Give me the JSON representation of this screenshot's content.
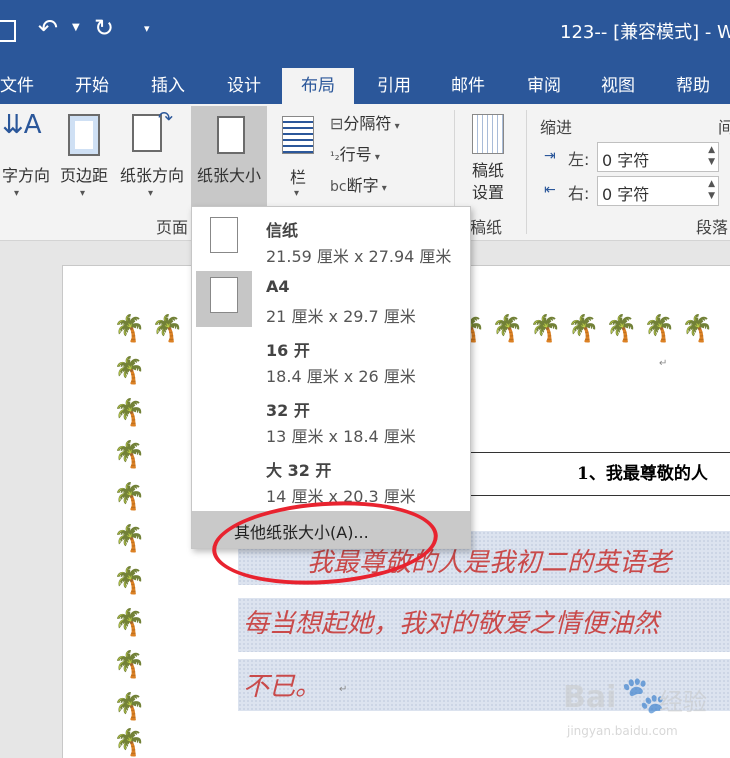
{
  "title_bar": {
    "title": "123-- [兼容模式] -  W"
  },
  "tabs": [
    "文件",
    "开始",
    "插入",
    "设计",
    "布局",
    "引用",
    "邮件",
    "审阅",
    "视图",
    "帮助"
  ],
  "active_tab": "布局",
  "ribbon": {
    "text_direction": "字方向",
    "margins": "页边距",
    "orientation": "纸张方向",
    "size": "纸张大小",
    "columns": "栏",
    "breaks": "分隔符",
    "line_numbers": "行号",
    "hyphenation": "断字",
    "page_setup_group": "页面",
    "draft_paper": "稿纸\n设置",
    "draft_group": "稿纸",
    "indent_label": "缩进",
    "spacing_label_partial": "间",
    "indent_left_label": "左:",
    "indent_left_value": "0 字符",
    "indent_right_label": "右:",
    "indent_right_value": "0 字符",
    "paragraph_group": "段落"
  },
  "dropdown": {
    "options": [
      {
        "name": "信纸",
        "dims": "21.59 厘米 x 27.94 厘米",
        "selected": false
      },
      {
        "name": "A4",
        "dims": "21 厘米 x 29.7 厘米",
        "selected": true
      },
      {
        "name": "16 开",
        "dims": "18.4 厘米 x 26 厘米",
        "selected": false
      },
      {
        "name": "32 开",
        "dims": "13 厘米 x 18.4 厘米",
        "selected": false
      },
      {
        "name": "大 32 开",
        "dims": "14 厘米 x 20.3 厘米",
        "selected": false
      }
    ],
    "more_sizes": "其他纸张大小(A)..."
  },
  "document": {
    "heading": "1、我最尊敬的人",
    "line1": "我最尊敬的人是我初二的英语老",
    "line2": "每当想起她，我对的敬爱之情便油然",
    "line3": "不已。"
  },
  "watermark": {
    "brand": "Bai",
    "cn": "经验",
    "url": "jingyan.baidu.com"
  },
  "colors": {
    "title_bar": "#2b579a",
    "ribbon": "#f3f3f3",
    "highlight_circle": "#e8232f",
    "doc_text": "#c94a4a"
  }
}
